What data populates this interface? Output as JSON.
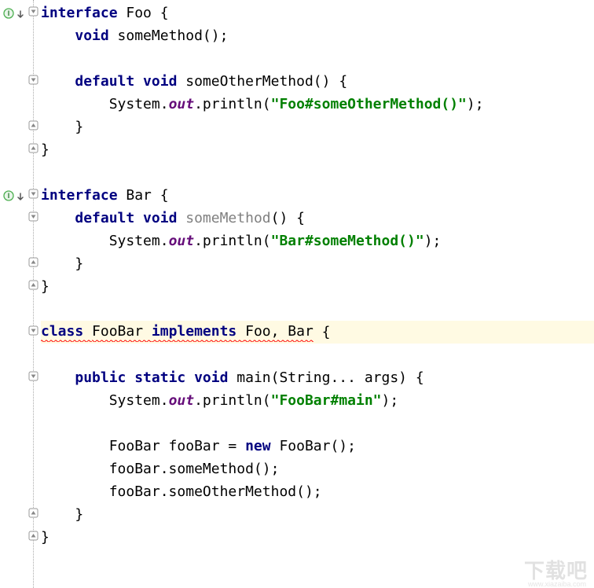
{
  "code": {
    "lines": [
      {
        "tokens": [
          {
            "t": "interface ",
            "c": "kw"
          },
          {
            "t": "Foo {",
            "c": ""
          }
        ],
        "indent": 0,
        "gutter": {
          "marker": "interface",
          "override": true,
          "fold": "open"
        }
      },
      {
        "tokens": [
          {
            "t": "void ",
            "c": "kw"
          },
          {
            "t": "someMethod();",
            "c": ""
          }
        ],
        "indent": 1,
        "gutter": {}
      },
      {
        "tokens": [],
        "indent": 0,
        "gutter": {}
      },
      {
        "tokens": [
          {
            "t": "default void ",
            "c": "kw"
          },
          {
            "t": "someOtherMethod() {",
            "c": ""
          }
        ],
        "indent": 1,
        "gutter": {
          "fold": "open"
        }
      },
      {
        "tokens": [
          {
            "t": "System.",
            "c": ""
          },
          {
            "t": "out",
            "c": "field"
          },
          {
            "t": ".println(",
            "c": ""
          },
          {
            "t": "\"Foo#someOtherMethod()\"",
            "c": "str"
          },
          {
            "t": ");",
            "c": ""
          }
        ],
        "indent": 2,
        "gutter": {}
      },
      {
        "tokens": [
          {
            "t": "}",
            "c": ""
          }
        ],
        "indent": 1,
        "gutter": {
          "fold": "close"
        }
      },
      {
        "tokens": [
          {
            "t": "}",
            "c": ""
          }
        ],
        "indent": 0,
        "gutter": {
          "fold": "close"
        }
      },
      {
        "tokens": [],
        "indent": 0,
        "gutter": {}
      },
      {
        "tokens": [
          {
            "t": "interface ",
            "c": "kw"
          },
          {
            "t": "Bar {",
            "c": ""
          }
        ],
        "indent": 0,
        "gutter": {
          "marker": "interface",
          "override": true,
          "fold": "open"
        }
      },
      {
        "tokens": [
          {
            "t": "default void ",
            "c": "kw"
          },
          {
            "t": "someMethod",
            "c": "unused"
          },
          {
            "t": "() {",
            "c": ""
          }
        ],
        "indent": 1,
        "gutter": {
          "fold": "open"
        }
      },
      {
        "tokens": [
          {
            "t": "System.",
            "c": ""
          },
          {
            "t": "out",
            "c": "field"
          },
          {
            "t": ".println(",
            "c": ""
          },
          {
            "t": "\"Bar#someMethod()\"",
            "c": "str"
          },
          {
            "t": ");",
            "c": ""
          }
        ],
        "indent": 2,
        "gutter": {}
      },
      {
        "tokens": [
          {
            "t": "}",
            "c": ""
          }
        ],
        "indent": 1,
        "gutter": {
          "fold": "close"
        }
      },
      {
        "tokens": [
          {
            "t": "}",
            "c": ""
          }
        ],
        "indent": 0,
        "gutter": {
          "fold": "close"
        }
      },
      {
        "tokens": [],
        "indent": 0,
        "gutter": {}
      },
      {
        "tokens": [
          {
            "t": "class ",
            "c": "kw",
            "err": true
          },
          {
            "t": "FooBar ",
            "c": "",
            "err": true
          },
          {
            "t": "implements ",
            "c": "kw",
            "err": true
          },
          {
            "t": "Foo, Bar",
            "c": "",
            "err": true
          },
          {
            "t": " {",
            "c": ""
          }
        ],
        "indent": 0,
        "gutter": {
          "fold": "open"
        },
        "highlight": true
      },
      {
        "tokens": [],
        "indent": 0,
        "gutter": {}
      },
      {
        "tokens": [
          {
            "t": "public static void ",
            "c": "kw"
          },
          {
            "t": "main(String... args) {",
            "c": ""
          }
        ],
        "indent": 1,
        "gutter": {
          "fold": "open"
        }
      },
      {
        "tokens": [
          {
            "t": "System.",
            "c": ""
          },
          {
            "t": "out",
            "c": "field"
          },
          {
            "t": ".println(",
            "c": ""
          },
          {
            "t": "\"FooBar#main\"",
            "c": "str"
          },
          {
            "t": ");",
            "c": ""
          }
        ],
        "indent": 2,
        "gutter": {}
      },
      {
        "tokens": [],
        "indent": 0,
        "gutter": {}
      },
      {
        "tokens": [
          {
            "t": "FooBar fooBar = ",
            "c": ""
          },
          {
            "t": "new ",
            "c": "kw"
          },
          {
            "t": "FooBar();",
            "c": ""
          }
        ],
        "indent": 2,
        "gutter": {}
      },
      {
        "tokens": [
          {
            "t": "fooBar.someMethod();",
            "c": ""
          }
        ],
        "indent": 2,
        "gutter": {}
      },
      {
        "tokens": [
          {
            "t": "fooBar.someOtherMethod();",
            "c": ""
          }
        ],
        "indent": 2,
        "gutter": {}
      },
      {
        "tokens": [
          {
            "t": "}",
            "c": ""
          }
        ],
        "indent": 1,
        "gutter": {
          "fold": "close"
        }
      },
      {
        "tokens": [
          {
            "t": "}",
            "c": ""
          }
        ],
        "indent": 0,
        "gutter": {
          "fold": "close"
        }
      }
    ]
  },
  "watermark": "下载吧",
  "watermark_sub": "www.xiazaiba.com"
}
